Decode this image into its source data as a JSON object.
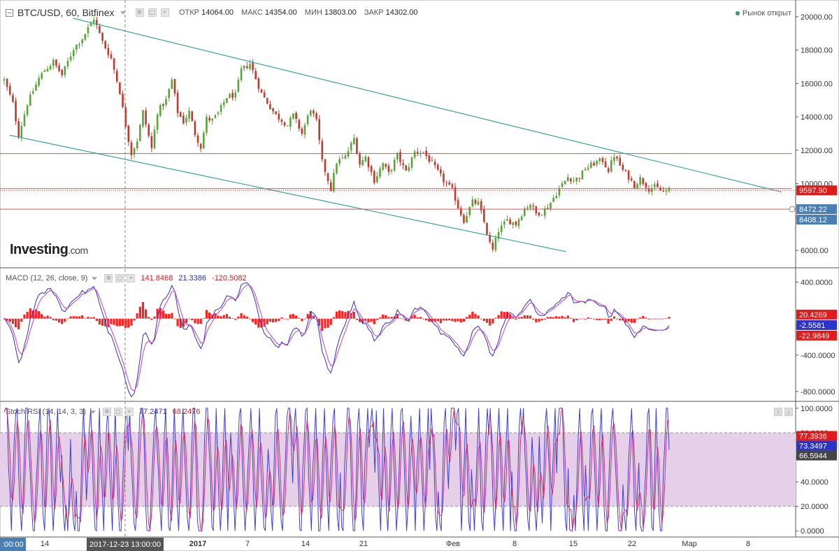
{
  "header": {
    "symbol": "BTC/USD, 60, Bitfinex",
    "open_label": "ОТКР",
    "open": "14064.00",
    "high_label": "МАКС",
    "high": "14354.00",
    "low_label": "МИН",
    "low": "13803.00",
    "close_label": "ЗАКР",
    "close": "14302.00",
    "market_status": "Рынок открыт"
  },
  "logo": {
    "brand": "Investing",
    "suffix": ".com"
  },
  "colors": {
    "up": "#5aa33b",
    "down": "#c0392b",
    "channel": "#3ba39b",
    "level": "#d9534f",
    "macd": "#3030c0",
    "signal": "#c040c0",
    "hist": "#ff2020",
    "stoch_k": "#4040d0",
    "stoch_d": "#d03070",
    "stoch_band": "#e6cfe8",
    "crosshair": "#888888"
  },
  "chart_data": [
    {
      "type": "candlestick",
      "title": "BTC/USD, 60, Bitfinex",
      "ylim": [
        5000,
        21000
      ],
      "yticks": [
        "20000.00",
        "18000.00",
        "16000.00",
        "14000.00",
        "12000.00",
        "10000.00",
        "8000.00",
        "6000.00"
      ],
      "anchors": [
        [
          0,
          16200
        ],
        [
          3,
          14800
        ],
        [
          5,
          12900
        ],
        [
          8,
          14800
        ],
        [
          12,
          16300
        ],
        [
          14,
          16800
        ],
        [
          17,
          17300
        ],
        [
          20,
          16500
        ],
        [
          24,
          18100
        ],
        [
          27,
          18700
        ],
        [
          31,
          19900
        ],
        [
          34,
          18500
        ],
        [
          37,
          17500
        ],
        [
          40,
          15500
        ],
        [
          42,
          13500
        ],
        [
          44,
          11800
        ],
        [
          46,
          12600
        ],
        [
          48,
          14300
        ],
        [
          51,
          12100
        ],
        [
          53,
          14300
        ],
        [
          56,
          15000
        ],
        [
          58,
          16200
        ],
        [
          60,
          14300
        ],
        [
          62,
          13700
        ],
        [
          64,
          14300
        ],
        [
          66,
          13000
        ],
        [
          68,
          12200
        ],
        [
          70,
          13900
        ],
        [
          72,
          13800
        ],
        [
          74,
          14200
        ],
        [
          77,
          15200
        ],
        [
          80,
          15300
        ],
        [
          82,
          16800
        ],
        [
          85,
          17200
        ],
        [
          87,
          16300
        ],
        [
          89,
          15400
        ],
        [
          92,
          14600
        ],
        [
          94,
          14100
        ],
        [
          96,
          13800
        ],
        [
          98,
          13500
        ],
        [
          100,
          14100
        ],
        [
          103,
          13000
        ],
        [
          106,
          14500
        ],
        [
          108,
          13700
        ],
        [
          110,
          11300
        ],
        [
          113,
          9700
        ],
        [
          115,
          11300
        ],
        [
          118,
          11600
        ],
        [
          121,
          12700
        ],
        [
          123,
          11200
        ],
        [
          125,
          11600
        ],
        [
          128,
          10200
        ],
        [
          131,
          11200
        ],
        [
          133,
          10600
        ],
        [
          136,
          11700
        ],
        [
          139,
          10700
        ],
        [
          142,
          11900
        ],
        [
          145,
          11900
        ],
        [
          148,
          11200
        ],
        [
          150,
          10700
        ],
        [
          152,
          10200
        ],
        [
          155,
          9600
        ],
        [
          157,
          8600
        ],
        [
          159,
          7800
        ],
        [
          162,
          8900
        ],
        [
          164,
          8800
        ],
        [
          166,
          7700
        ],
        [
          168,
          6400
        ],
        [
          169,
          6000
        ],
        [
          171,
          7200
        ],
        [
          174,
          7800
        ],
        [
          177,
          7600
        ],
        [
          180,
          8500
        ],
        [
          182,
          8800
        ],
        [
          184,
          8200
        ],
        [
          186,
          8300
        ],
        [
          188,
          8600
        ],
        [
          192,
          9700
        ],
        [
          195,
          10400
        ],
        [
          197,
          10200
        ],
        [
          199,
          10400
        ],
        [
          201,
          10900
        ],
        [
          203,
          11100
        ],
        [
          205,
          11300
        ],
        [
          207,
          11400
        ],
        [
          209,
          10800
        ],
        [
          211,
          11700
        ],
        [
          212,
          11400
        ],
        [
          214,
          10800
        ],
        [
          216,
          10400
        ],
        [
          218,
          9900
        ],
        [
          220,
          10300
        ],
        [
          223,
          9700
        ],
        [
          225,
          9800
        ],
        [
          228,
          9500
        ],
        [
          230,
          9597.9
        ]
      ],
      "channel_upper": [
        [
          "Dec 10",
          19900
        ],
        [
          "Feb 28",
          9500
        ]
      ],
      "channel_lower": [
        [
          "Dec 08",
          12900
        ],
        [
          "Feb 06",
          5900
        ]
      ],
      "horizontal_levels": [
        11800,
        9700,
        8472.22
      ],
      "price_labels": {
        "last": "9597.90",
        "level_a": "8472.22",
        "level_b": "8408.12"
      }
    },
    {
      "type": "line+histogram",
      "title": "MACD (12, 26, close, 9)",
      "values_shown": [
        "141.8468",
        "21.3386",
        "-120.5082"
      ],
      "ylim": [
        -900,
        550
      ],
      "yticks": [
        "400.0000",
        "-400.0000",
        "-800.0000"
      ],
      "price_labels": {
        "a": "20.4269",
        "b": "-2.5581",
        "c": "-22.9849"
      }
    },
    {
      "type": "line",
      "title": "Stoch RSI (14, 14, 3, 3)",
      "values_shown": [
        "77.2471",
        "68.2476"
      ],
      "ylim": [
        -5,
        105
      ],
      "band": [
        20,
        80
      ],
      "yticks": [
        "100.0000",
        "80.0000",
        "60.0000",
        "40.0000",
        "20.0000",
        "0.0000"
      ],
      "price_labels": {
        "a": "77.3936",
        "b": "73.3497",
        "c": "66.5944"
      }
    }
  ],
  "xaxis": {
    "ticks": [
      "14",
      "2017",
      "7",
      "14",
      "21",
      "Фев",
      "8",
      "15",
      "22",
      "Мар",
      "8"
    ],
    "left_label": ":00:00",
    "crosshair_label": "2017-12-23 13:00:00"
  }
}
